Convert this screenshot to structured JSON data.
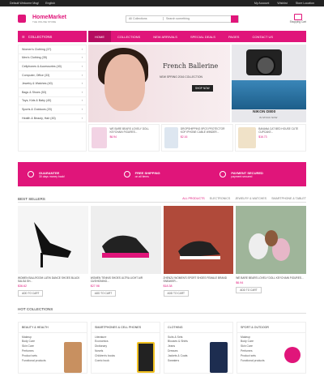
{
  "topbar": {
    "welcome": "Default Welcome Msg!",
    "lang": "English",
    "account": "My Account",
    "wishlist": "Wishlist",
    "store": "Store Location"
  },
  "logo": {
    "title": "HomeMarket",
    "subtitle": "THE ONLINE STORE"
  },
  "search": {
    "category": "All Collections",
    "placeholder": "Search something"
  },
  "cart": {
    "label": "Shopping Cart"
  },
  "nav": {
    "collections": "COLLECTIONS",
    "menu": [
      "HOME",
      "COLLECTIONS",
      "NEW ARRIVALS",
      "SPECIAL DEALS",
      "PAGES",
      "CONTACT US"
    ]
  },
  "sidebar": [
    "Women's Clothing (37)",
    "Men's Clothing (35)",
    "Cellphones & Accessories (40)",
    "Computer, Office (33)",
    "Jewelry & Watches (40)",
    "Bags & Shoes (53)",
    "Toys, Kids & Baby (40)",
    "Sports & Outdoors (20)",
    "Health & Beauty, Hair (45)"
  ],
  "banner1": {
    "title": "French Ballerine",
    "sub": "NEW SPRING 2016 COLLECTION",
    "btn": "SHOP NOW"
  },
  "banner2": {
    "title": "NIKON D800",
    "sub": "IN STOCK NOW"
  },
  "products": [
    {
      "title": "WE BARE BEARS LOVELY DOLL KEYCHAIN FIGURES...",
      "price": "$6.94"
    },
    {
      "title": "DROPSHIPPING 5PCS PROTECTOR KOF IPHONE CABLE WINDER...",
      "price": "$2.16"
    },
    {
      "title": "BANANA CAT BED HOUSE CUTE CUPCAKE...",
      "price": "$16.73"
    }
  ],
  "features": [
    {
      "title": "GUARANTEE",
      "sub": "30 days money back!"
    },
    {
      "title": "FREE SHIPPING",
      "sub": "on all items"
    },
    {
      "title": "PAYMENT SECURED",
      "sub": "payment secured"
    }
  ],
  "bestsellers": {
    "title": "BEST SELLERS",
    "tabs": [
      "ALL PRODUCTS",
      "ELECTRONICS",
      "JEWELRY & WATCHES",
      "SMARTPHONE & TABLET"
    ],
    "items": [
      {
        "title": "WOMEN BALLROOM LATIN DANCE SHOES BLACK SALSA SH...",
        "price": "$36.62"
      },
      {
        "title": "WOMEN TENNIS SHOES ULTRA LIGHT AIR CUSHIONING...",
        "price": "$27.98"
      },
      {
        "title": "ZHENZU WOMEN'S SPORT SHOES FEMALE BRAND SNEAKER...",
        "price": "$18.38"
      },
      {
        "title": "WE BARE BEARS LOVELY DOLL KEYCHAIN FIGURES...",
        "price": "$6.94"
      }
    ],
    "cart_label": "ADD TO CART"
  },
  "hot": {
    "title": "HOT COLLECTIONS",
    "cols": [
      {
        "title": "BEAUTY & HEALTH",
        "items": [
          "Makeup",
          "Body Care",
          "Skin Care",
          "Perfumes",
          "Product sets",
          "Functional products"
        ]
      },
      {
        "title": "SMARTPHONES & CELL PHONES",
        "items": [
          "Literature",
          "Economics",
          "Dictionary",
          "Novels",
          "Children's books",
          "Comic book"
        ]
      },
      {
        "title": "CLOTHING",
        "items": [
          "Suits & Sets",
          "Blouses & Shirts",
          "Jeans",
          "Dresses",
          "Jackets & Coats",
          "Sweaters"
        ]
      },
      {
        "title": "SPORT & OUTDOOR",
        "items": [
          "Makeup",
          "Body Care",
          "Skin Care",
          "Perfumes",
          "Product sets",
          "Functional products"
        ]
      }
    ]
  },
  "colors": {
    "accent": "#e0157a"
  }
}
